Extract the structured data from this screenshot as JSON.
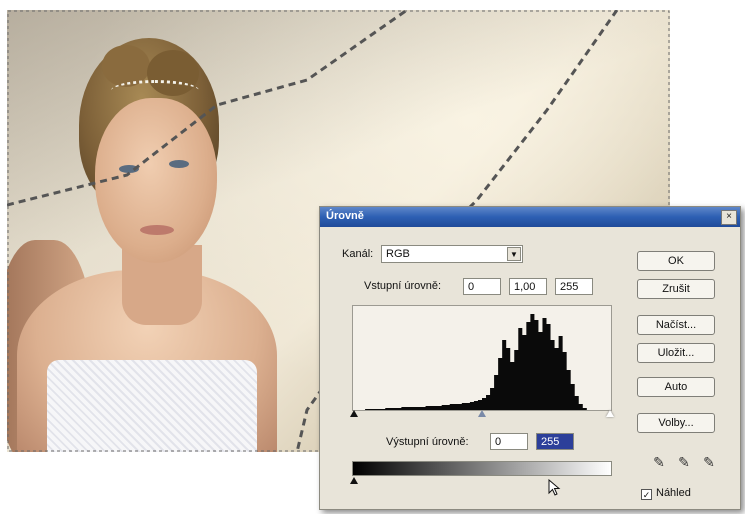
{
  "dialog": {
    "title": "Úrovně",
    "close_glyph": "×",
    "channel_label": "Kanál:",
    "channel_value": "RGB",
    "input_levels_label": "Vstupní úrovně:",
    "input_black": "0",
    "input_gamma": "1,00",
    "input_white": "255",
    "output_levels_label": "Výstupní úrovně:",
    "output_black": "0",
    "output_white": "255",
    "buttons": {
      "ok": "OK",
      "cancel": "Zrušit",
      "load": "Načíst...",
      "save": "Uložit...",
      "auto": "Auto",
      "options": "Volby..."
    },
    "preview_label": "Náhled",
    "preview_checked": true,
    "preview_check_glyph": "✓",
    "eyedropper_glyph": "✎",
    "dropdown_glyph": "▼"
  },
  "histogram": {
    "bins_description_excluded": true,
    "values": [
      0,
      0,
      0,
      1,
      1,
      1,
      1,
      1,
      2,
      2,
      2,
      2,
      3,
      3,
      3,
      3,
      3,
      3,
      4,
      4,
      4,
      4,
      5,
      5,
      6,
      6,
      6,
      7,
      7,
      8,
      9,
      10,
      12,
      15,
      22,
      35,
      52,
      70,
      62,
      48,
      60,
      82,
      75,
      88,
      96,
      90,
      78,
      92,
      86,
      70,
      62,
      74,
      58,
      40,
      26,
      14,
      6,
      2,
      0,
      0,
      0,
      0,
      0,
      0
    ]
  },
  "colors": {
    "titlebar": "#2d5fb3",
    "dialog_bg": "#e8e4d9",
    "selected_field": "#2c3f9a",
    "marquee": "#4a4a4a"
  }
}
